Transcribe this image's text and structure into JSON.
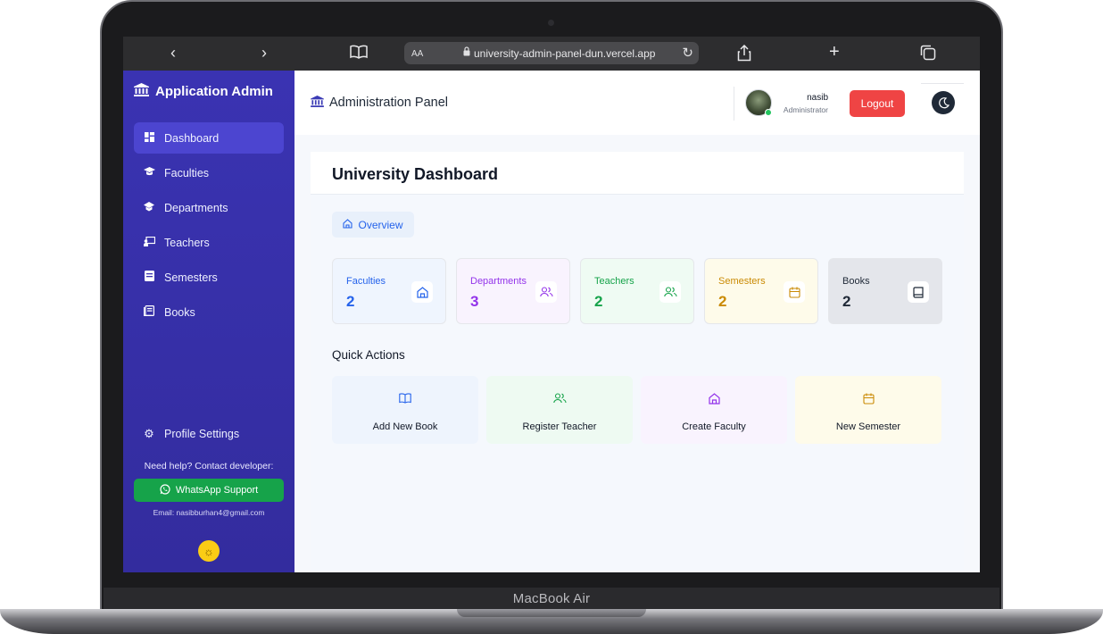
{
  "device": {
    "label": "MacBook Air"
  },
  "browser": {
    "aa": "AA",
    "url": "university-admin-panel-dun.vercel.app",
    "icons": [
      "back-chevron-icon",
      "forward-chevron-icon",
      "book-icon",
      "lock-icon",
      "reload-icon",
      "share-icon",
      "plus-icon",
      "tabs-icon"
    ]
  },
  "sidebar": {
    "brand": "Application Admin",
    "items": [
      {
        "label": "Dashboard",
        "icon": "dashboard-icon"
      },
      {
        "label": "Faculties",
        "icon": "graduation-cap-icon"
      },
      {
        "label": "Departments",
        "icon": "school-icon"
      },
      {
        "label": "Teachers",
        "icon": "chalkboard-teacher-icon"
      },
      {
        "label": "Semesters",
        "icon": "calendar-icon"
      },
      {
        "label": "Books",
        "icon": "book-icon"
      }
    ],
    "profile_settings": "Profile Settings",
    "help": "Need help? Contact developer:",
    "whatsapp": "WhatsApp Support",
    "email": "Email: nasibburhan4@gmail.com"
  },
  "header": {
    "title": "Administration Panel",
    "user": {
      "name": "nasib",
      "role": "Administrator"
    },
    "logout": "Logout"
  },
  "main": {
    "title": "University Dashboard",
    "tab": "Overview",
    "stats": [
      {
        "label": "Faculties",
        "value": "2",
        "color": "#2563eb",
        "bg": "#eff5fe",
        "icon": "home-icon"
      },
      {
        "label": "Departments",
        "value": "3",
        "color": "#9333ea",
        "bg": "#f9f3fe",
        "icon": "users-icon"
      },
      {
        "label": "Teachers",
        "value": "2",
        "color": "#16a34a",
        "bg": "#effbf3",
        "icon": "users-icon"
      },
      {
        "label": "Semesters",
        "value": "2",
        "color": "#ca8a04",
        "bg": "#fefbea",
        "icon": "calendar-icon"
      },
      {
        "label": "Books",
        "value": "2",
        "color": "#1f2937",
        "bg": "#e4e6eb",
        "icon": "book-icon"
      }
    ],
    "quick_actions_heading": "Quick Actions",
    "quick_actions": [
      {
        "label": "Add New Book",
        "color": "#2563eb",
        "bg": "#eef4fd",
        "icon": "book-open-icon"
      },
      {
        "label": "Register Teacher",
        "color": "#16a34a",
        "bg": "#eefaf2",
        "icon": "users-icon"
      },
      {
        "label": "Create Faculty",
        "color": "#9333ea",
        "bg": "#f9f3fe",
        "icon": "home-icon"
      },
      {
        "label": "New Semester",
        "color": "#ca8a04",
        "bg": "#fefbea",
        "icon": "calendar-icon"
      }
    ]
  }
}
